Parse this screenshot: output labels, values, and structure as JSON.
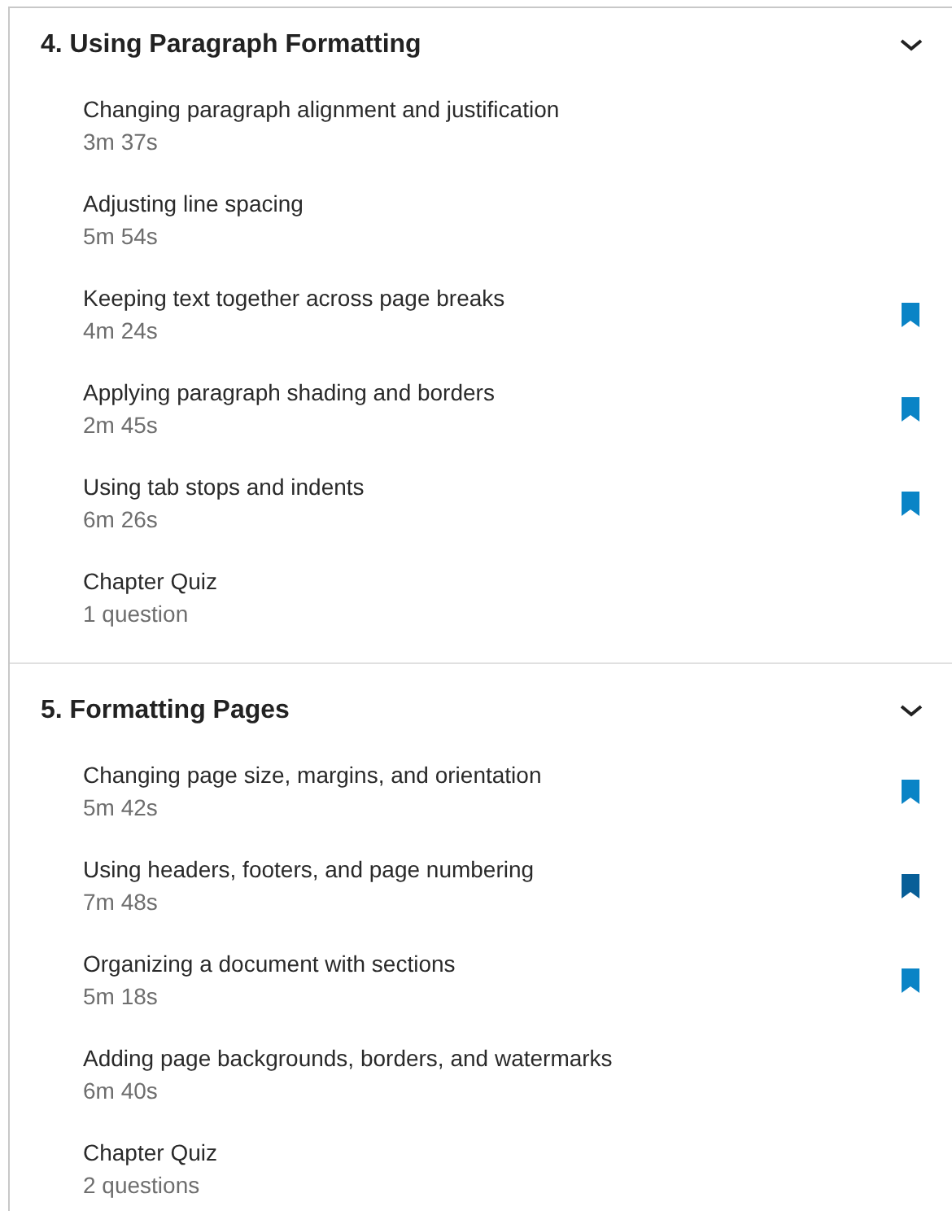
{
  "sections": [
    {
      "title": "4. Using Paragraph Formatting",
      "expanded": true,
      "items": [
        {
          "title": "Changing paragraph alignment and justification",
          "duration": "3m 37s",
          "bookmarked": false
        },
        {
          "title": "Adjusting line spacing",
          "duration": "5m 54s",
          "bookmarked": false
        },
        {
          "title": "Keeping text together across page breaks",
          "duration": "4m 24s",
          "bookmarked": true,
          "color": "#0a84c6"
        },
        {
          "title": "Applying paragraph shading and borders",
          "duration": "2m 45s",
          "bookmarked": true,
          "color": "#0a84c6"
        },
        {
          "title": "Using tab stops and indents",
          "duration": "6m 26s",
          "bookmarked": true,
          "color": "#0a84c6"
        },
        {
          "title": "Chapter Quiz",
          "duration": "1 question",
          "bookmarked": false
        }
      ]
    },
    {
      "title": "5. Formatting Pages",
      "expanded": true,
      "items": [
        {
          "title": "Changing page size, margins, and orientation",
          "duration": "5m 42s",
          "bookmarked": true,
          "color": "#0a84c6"
        },
        {
          "title": "Using headers, footers, and page numbering",
          "duration": "7m 48s",
          "bookmarked": true,
          "color": "#085f98"
        },
        {
          "title": "Organizing a document with sections",
          "duration": "5m 18s",
          "bookmarked": true,
          "color": "#0a84c6"
        },
        {
          "title": "Adding page backgrounds, borders, and watermarks",
          "duration": "6m 40s",
          "bookmarked": false
        },
        {
          "title": "Chapter Quiz",
          "duration": "2 questions",
          "bookmarked": false
        }
      ]
    }
  ]
}
